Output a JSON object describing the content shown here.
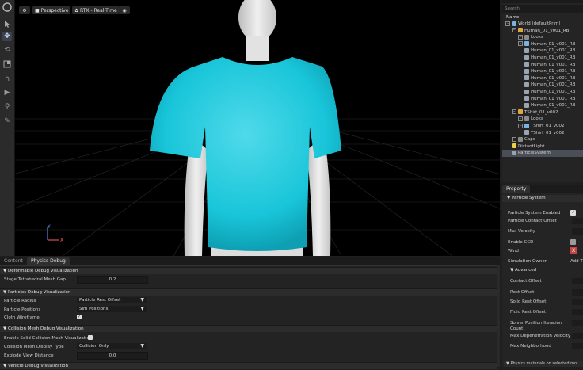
{
  "viewport": {
    "camera_label": "Perspective",
    "render_label": "RTX - Real-Time",
    "axis_y": "Y",
    "axis_x": "X"
  },
  "bottom_panel": {
    "tabs": [
      {
        "label": "Content"
      },
      {
        "label": "Physics Debug"
      }
    ],
    "deformable": {
      "header": "Deformable Debug Visualization",
      "mesh_gap_label": "Stage Tetrahedral Mesh Gap",
      "mesh_gap_value": "0.2"
    },
    "particles": {
      "header": "Particles Debug Visualization",
      "radius_label": "Particle Radius",
      "radius_value": "Particle Rest Offset",
      "positions_label": "Particle Positions",
      "positions_value": "Sim Positions",
      "cloth_label": "Cloth Wireframe"
    },
    "collision": {
      "header": "Collision Mesh Debug Visualization",
      "enable_label": "Enable Solid Collision Mesh Visualization",
      "display_label": "Collision Mesh Display Type",
      "display_value": "Collision Only",
      "explode_label": "Explode View Distance",
      "explode_value": "0.0"
    },
    "vehicle_header": "Vehicle Debug Visualization"
  },
  "stage": {
    "search_placeholder": "Search",
    "column_name": "Name",
    "tree": [
      {
        "label": "World (defaultPrim)",
        "indent": 0,
        "icon": "xform",
        "expander": true
      },
      {
        "label": "Human_01_v001_RB",
        "indent": 1,
        "icon": "skel",
        "expander": true
      },
      {
        "label": "Looks",
        "indent": 2,
        "icon": "folder",
        "expander": true
      },
      {
        "label": "Human_01_v001_RB",
        "indent": 2,
        "icon": "xform",
        "expander": true
      },
      {
        "label": "Human_01_v001_RB",
        "indent": 3,
        "icon": "mesh"
      },
      {
        "label": "Human_01_v001_RB",
        "indent": 3,
        "icon": "mesh"
      },
      {
        "label": "Human_01_v001_RB",
        "indent": 3,
        "icon": "mesh"
      },
      {
        "label": "Human_01_v001_RB",
        "indent": 3,
        "icon": "mesh"
      },
      {
        "label": "Human_01_v001_RB",
        "indent": 3,
        "icon": "mesh"
      },
      {
        "label": "Human_01_v001_RB",
        "indent": 3,
        "icon": "mesh"
      },
      {
        "label": "Human_01_v001_RB",
        "indent": 3,
        "icon": "mesh"
      },
      {
        "label": "Human_01_v001_RB",
        "indent": 3,
        "icon": "mesh"
      },
      {
        "label": "Human_01_v001_RB",
        "indent": 3,
        "icon": "mesh"
      },
      {
        "label": "TShirt_01_v002",
        "indent": 1,
        "icon": "skel",
        "expander": true
      },
      {
        "label": "Looks",
        "indent": 2,
        "icon": "folder",
        "expander": true
      },
      {
        "label": "TShirt_01_v002",
        "indent": 2,
        "icon": "xform",
        "expander": true
      },
      {
        "label": "TShirt_01_v002",
        "indent": 3,
        "icon": "mesh"
      },
      {
        "label": "Cape",
        "indent": 1,
        "icon": "folder",
        "expander": true
      },
      {
        "label": "DistantLight",
        "indent": 1,
        "icon": "light"
      },
      {
        "label": "ParticleSystem",
        "indent": 1,
        "icon": "mesh",
        "selected": true
      }
    ]
  },
  "property": {
    "tab_label": "Property",
    "section": "Particle System",
    "rows": [
      {
        "label": "Particle System Enabled",
        "control": "check"
      },
      {
        "label": "Particle Contact Offset",
        "control": "field"
      },
      {
        "label": "Max Velocity",
        "control": "field"
      },
      {
        "label": "Enable CCD",
        "control": "box"
      },
      {
        "label": "Wind",
        "control": "x"
      },
      {
        "label": "Simulation Owner",
        "control": "add"
      }
    ],
    "add_label": "Add T",
    "x_label": "X",
    "advanced_header": "Advanced",
    "advanced_rows": [
      {
        "label": "Contact Offset"
      },
      {
        "label": "Rest Offset"
      },
      {
        "label": "Solid Rest Offset"
      },
      {
        "label": "Fluid Rest Offset"
      },
      {
        "label": "Solver Position Iteration Count"
      },
      {
        "label": "Max Depenetration Velocity"
      },
      {
        "label": "Max Neighborhood"
      }
    ],
    "footer": "Physics materials on selected mo"
  },
  "colors": {
    "shirt": "#19c5d9",
    "selection": "#4a4f57",
    "accent_red": "#c44444"
  }
}
